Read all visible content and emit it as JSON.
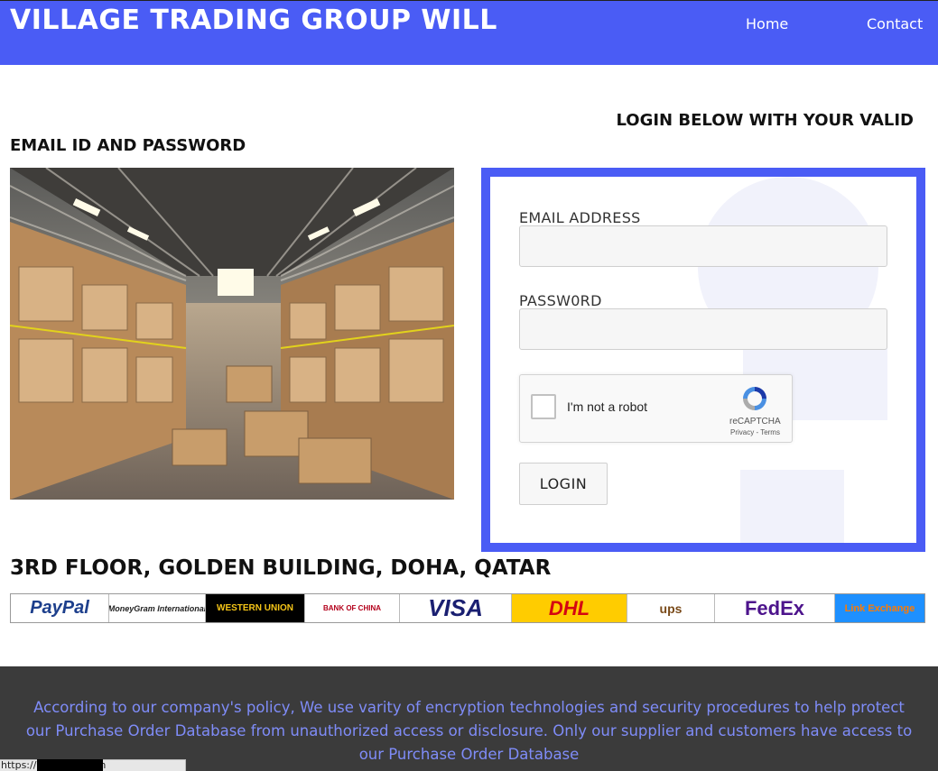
{
  "header": {
    "title": "VILLAGE TRADING GROUP WILL",
    "nav": [
      {
        "label": "Home"
      },
      {
        "label": "Contact"
      }
    ],
    "color": "#4a5cf5"
  },
  "headline": {
    "line1": "LOGIN BELOW WITH YOUR VALID",
    "line2": "EMAIL ID AND PASSWORD"
  },
  "form": {
    "email_label": "EMAIL ADDRESS",
    "email_value": "",
    "password_label": "PASSW0RD",
    "password_value": "",
    "recaptcha_text": "I'm not a robot",
    "recaptcha_brand": "reCAPTCHA",
    "recaptcha_terms": "Privacy - Terms",
    "login_label": "LOGIN"
  },
  "address": "3RD FLOOR, GOLDEN BUILDING, DOHA, QATAR",
  "payment_logos": [
    {
      "label": "PayPal",
      "color": "#1d3f8c",
      "bg": "#ffffff"
    },
    {
      "label": "MoneyGram International",
      "color": "#222222",
      "bg": "#ffffff"
    },
    {
      "label": "WESTERN UNION",
      "color": "#f5c518",
      "bg": "#000000"
    },
    {
      "label": "BANK OF CHINA",
      "color": "#b3001b",
      "bg": "#ffffff"
    },
    {
      "label": "VISA",
      "color": "#1a1f71",
      "bg": "#ffffff"
    },
    {
      "label": "DHL",
      "color": "#d40511",
      "bg": "#ffcc00"
    },
    {
      "label": "ups",
      "color": "#f7c200",
      "bg": "#ffffff"
    },
    {
      "label": "FedEx",
      "color": "#4d148c",
      "bg": "#ffffff"
    },
    {
      "label": "Link Exchange",
      "color": "#ff7a00",
      "bg": "#1e90ff"
    }
  ],
  "footer": {
    "text": "According to our company's policy, We use varity of encryption technologies and security procedures to help protect our Purchase Order Database from unauthorized access or disclosure. Only our supplier and customers have access to our Purchase Order Database"
  },
  "status_bar": {
    "url": "https://                .volasite.com"
  }
}
